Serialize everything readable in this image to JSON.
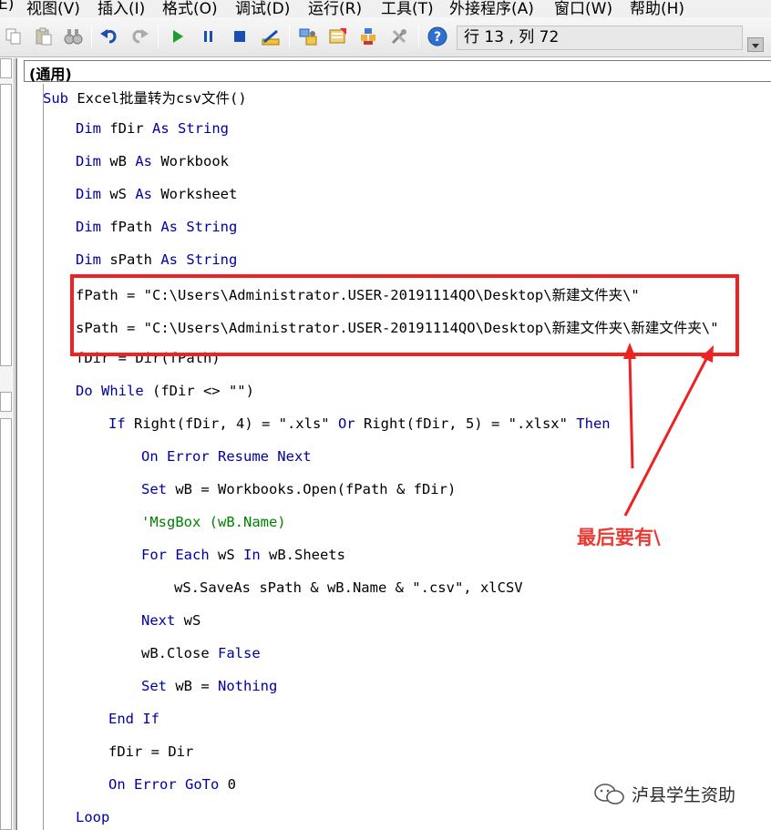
{
  "menubar": {
    "items": [
      "E)",
      "视图(V)",
      "插入(I)",
      "格式(O)",
      "调试(D)",
      "运行(R)",
      "工具(T)",
      "外接程序(A)",
      "窗口(W)",
      "帮助(H)"
    ]
  },
  "toolbar": {
    "icons": [
      "copy-icon",
      "paste-icon",
      "find-icon",
      "undo-icon",
      "redo-icon",
      "run-icon",
      "break-icon",
      "reset-icon",
      "design-mode-icon",
      "project-explorer-icon",
      "properties-icon",
      "object-browser-icon",
      "toolbox-icon",
      "help-icon"
    ],
    "status": "行 13 , 列 72"
  },
  "code_window": {
    "object_combo": "(通用)",
    "lines": [
      "Sub Excel批量转为csv文件()",
      "Dim fDir As String",
      "Dim wB As Workbook",
      "Dim wS As Worksheet",
      "Dim fPath As String",
      "Dim sPath As String",
      "fPath = \"C:\\Users\\Administrator.USER-20191114QO\\Desktop\\新建文件夹\\\"",
      "sPath = \"C:\\Users\\Administrator.USER-20191114QO\\Desktop\\新建文件夹\\新建文件夹\\\"",
      "fDir = Dir(fPath)",
      "Do While (fDir <> \"\")",
      "If Right(fDir, 4) = \".xls\" Or Right(fDir, 5) = \".xlsx\" Then",
      "On Error Resume Next",
      "Set wB = Workbooks.Open(fPath & fDir)",
      "'MsgBox (wB.Name)",
      "For Each wS In wB.Sheets",
      "wS.SaveAs sPath & wB.Name & \".csv\", xlCSV",
      "Next wS",
      "wB.Close False",
      "Set wB = Nothing",
      "End If",
      "fDir = Dir",
      "On Error GoTo 0",
      "Loop"
    ]
  },
  "annotation": {
    "note": "最后要有\\",
    "color": "#e83b34"
  },
  "watermark": {
    "text": "泸县学生资助"
  }
}
